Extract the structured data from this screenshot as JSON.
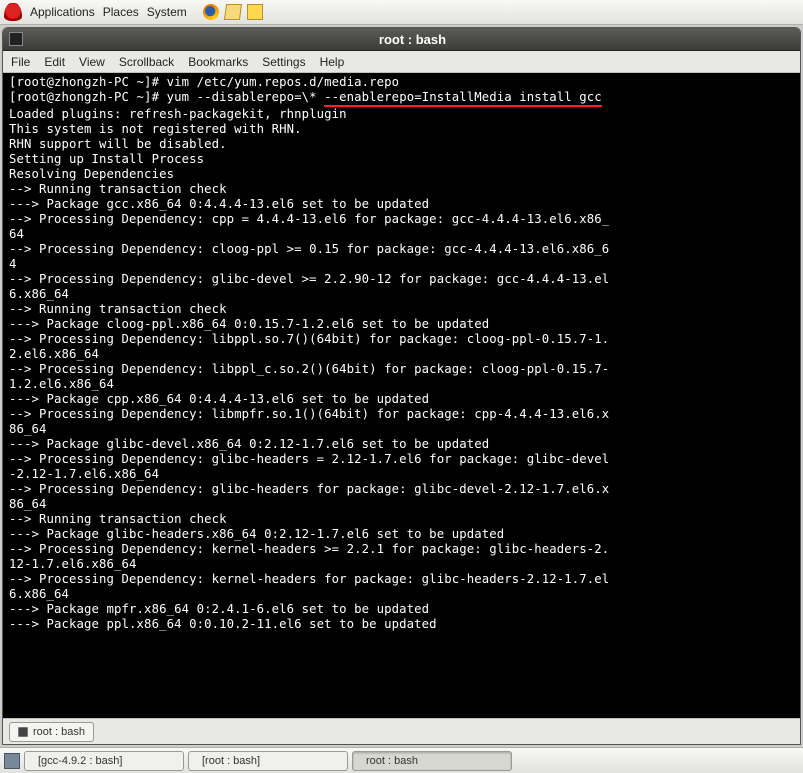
{
  "panel": {
    "menu": [
      "Applications",
      "Places",
      "System"
    ],
    "icons": [
      "firefox-icon",
      "mail-icon",
      "notes-icon"
    ]
  },
  "window": {
    "title": "root : bash",
    "menubar": [
      "File",
      "Edit",
      "View",
      "Scrollback",
      "Bookmarks",
      "Settings",
      "Help"
    ],
    "tabs": [
      "root : bash"
    ]
  },
  "terminal": {
    "prompt1": "[root@zhongzh-PC ~]# ",
    "cmd1": "vim /etc/yum.repos.d/media.repo",
    "prompt2": "[root@zhongzh-PC ~]# ",
    "cmd2a": "yum --disablerepo=\\* ",
    "cmd2b": "--enablerepo=InstallMedia install gcc",
    "output": "Loaded plugins: refresh-packagekit, rhnplugin\nThis system is not registered with RHN.\nRHN support will be disabled.\nSetting up Install Process\nResolving Dependencies\n--> Running transaction check\n---> Package gcc.x86_64 0:4.4.4-13.el6 set to be updated\n--> Processing Dependency: cpp = 4.4.4-13.el6 for package: gcc-4.4.4-13.el6.x86_\n64\n--> Processing Dependency: cloog-ppl >= 0.15 for package: gcc-4.4.4-13.el6.x86_6\n4\n--> Processing Dependency: glibc-devel >= 2.2.90-12 for package: gcc-4.4.4-13.el\n6.x86_64\n--> Running transaction check\n---> Package cloog-ppl.x86_64 0:0.15.7-1.2.el6 set to be updated\n--> Processing Dependency: libppl.so.7()(64bit) for package: cloog-ppl-0.15.7-1.\n2.el6.x86_64\n--> Processing Dependency: libppl_c.so.2()(64bit) for package: cloog-ppl-0.15.7-\n1.2.el6.x86_64\n---> Package cpp.x86_64 0:4.4.4-13.el6 set to be updated\n--> Processing Dependency: libmpfr.so.1()(64bit) for package: cpp-4.4.4-13.el6.x\n86_64\n---> Package glibc-devel.x86_64 0:2.12-1.7.el6 set to be updated\n--> Processing Dependency: glibc-headers = 2.12-1.7.el6 for package: glibc-devel\n-2.12-1.7.el6.x86_64\n--> Processing Dependency: glibc-headers for package: glibc-devel-2.12-1.7.el6.x\n86_64\n--> Running transaction check\n---> Package glibc-headers.x86_64 0:2.12-1.7.el6 set to be updated\n--> Processing Dependency: kernel-headers >= 2.2.1 for package: glibc-headers-2.\n12-1.7.el6.x86_64\n--> Processing Dependency: kernel-headers for package: glibc-headers-2.12-1.7.el\n6.x86_64\n---> Package mpfr.x86_64 0:2.4.1-6.el6 set to be updated\n---> Package ppl.x86_64 0:0.10.2-11.el6 set to be updated"
  },
  "taskbar": {
    "buttons": [
      "[gcc-4.9.2 : bash]",
      "[root : bash]",
      "root : bash"
    ],
    "active_index": 2
  }
}
